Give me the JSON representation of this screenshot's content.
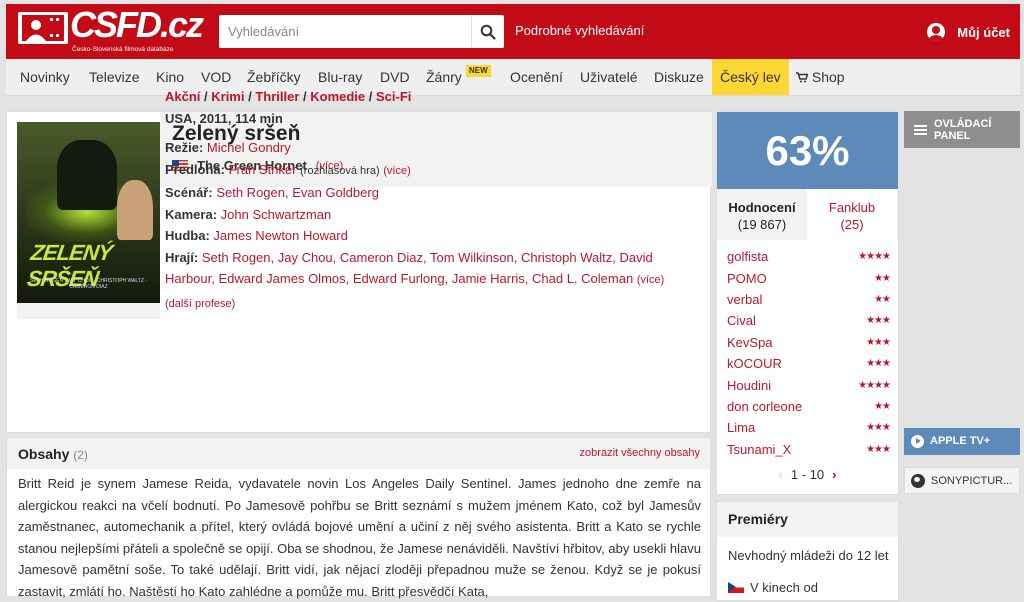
{
  "header": {
    "logo_text": "CSFD.cz",
    "logo_tagline": "Česko-Slovenská filmová databáze",
    "search_placeholder": "Vyhledávání",
    "advanced_search": "Podrobné vyhledávání",
    "account": "Můj účet"
  },
  "nav": {
    "items": [
      "Novinky",
      "Televize",
      "Kino",
      "VOD",
      "Žebříčky",
      "Blu-ray",
      "DVD",
      "Žánry",
      "Ocenění",
      "Uživatelé",
      "Diskuze",
      "Český lev",
      "Shop"
    ],
    "new_badge": "NEW"
  },
  "film": {
    "title": "Zelený sršeň",
    "original_title": "The Green Hornet",
    "more": "(více)",
    "genres": [
      "Akční",
      "Krimi",
      "Thriller",
      "Komedie",
      "Sci-Fi"
    ],
    "origin": "USA, 2011, 114 min",
    "poster": {
      "title": "ZELENÝ SRŠEŇ",
      "credits": "SETH ROGEN · JAY CHOU · CHRISTOPH WALTZ · CAMERON DIAZ"
    },
    "crew": {
      "director_label": "Režie:",
      "director": "Michel Gondry",
      "source_label": "Předloha:",
      "source": "Fran Striker",
      "source_note": "(rozhlasová hra)",
      "source_more": "(více)",
      "writers_label": "Scénář:",
      "writers": "Seth Rogen, Evan Goldberg",
      "camera_label": "Kamera:",
      "camera": "John Schwartzman",
      "music_label": "Hudba:",
      "music": "James Newton Howard",
      "cast_label": "Hrají:",
      "cast": "Seth Rogen, Jay Chou, Cameron Diaz, Tom Wilkinson, Christoph Waltz, David Harbour, Edward James Olmos, Edward Furlong, Jamie Harris, Chad L. Coleman",
      "cast_more": "(více)",
      "more_professions": "(další profese)"
    }
  },
  "summary": {
    "title": "Obsahy",
    "count": "(2)",
    "show_all": "zobrazit všechny obsahy",
    "text": "Britt Reid je synem Jamese Reida, vydavatele novin Los Angeles Daily Sentinel. James jednoho dne zemře na alergickou reakci na včelí bodnutí. Po Jamesově pohřbu se Britt seznámí s mužem jménem Kato, což byl Jamesův zaměstnanec, automechanik a přítel, který ovládá bojové umění a učiní z něj svého asistenta. Britt a Kato se rychle stanou nejlepšími přáteli a společně se opijí. Oba se shodnou, že Jamese nenáviděli. Navštíví hřbitov, aby usekli hlavu Jamesově pamětní soše. To také udělají. Britt vidí, jak nějací zloději přepadnou muže se ženou. Když se je pokusí zastavit, zmlátí ho. Naštěstí ho Kato zahlédne a pomůže mu. Britt přesvědčí Kata,"
  },
  "rating": {
    "percent": "63%",
    "tab_ratings": "Hodnocení",
    "ratings_count": "(19 867)",
    "tab_fanclub": "Fanklub",
    "fanclub_count": "(25)",
    "users": [
      {
        "name": "golfista",
        "stars": "★★★★"
      },
      {
        "name": "POMO",
        "stars": "★★"
      },
      {
        "name": "verbal",
        "stars": "★★"
      },
      {
        "name": "Cival",
        "stars": "★★★"
      },
      {
        "name": "KevSpa",
        "stars": "★★★"
      },
      {
        "name": "kOCOUR",
        "stars": "★★★"
      },
      {
        "name": "Houdini",
        "stars": "★★★★"
      },
      {
        "name": "don corleone",
        "stars": "★★"
      },
      {
        "name": "Lima",
        "stars": "★★★"
      },
      {
        "name": "Tsunami_X",
        "stars": "★★★"
      }
    ],
    "pager": "1 - 10"
  },
  "premieres": {
    "title": "Premiéry",
    "age": "Nevhodný mládeži do 12 let",
    "cinema": "V kinech od"
  },
  "sidebar": {
    "panel": "OVLÁDACÍ PANEL",
    "apple": "APPLE TV+",
    "sony": "SONYPICTUR..."
  },
  "colors": {
    "brand_red": "#c20b17",
    "link_red": "#b8192b",
    "rating_blue": "#5d8ab8",
    "highlight_yellow": "#fdd835"
  }
}
